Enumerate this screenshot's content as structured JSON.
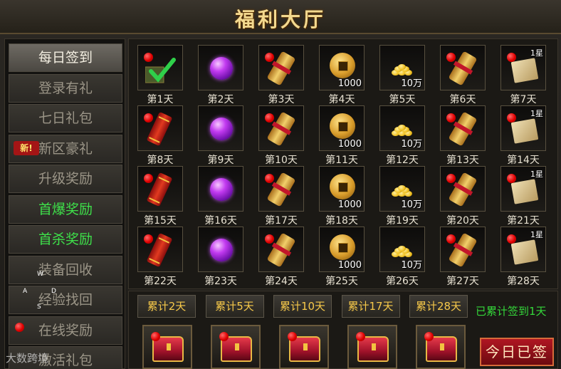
{
  "window": {
    "title": "福利大厅"
  },
  "sidebar": {
    "items": [
      {
        "label": "每日签到",
        "state": "active"
      },
      {
        "label": "登录有礼",
        "state": "normal"
      },
      {
        "label": "七日礼包",
        "state": "normal"
      },
      {
        "label": "新区豪礼",
        "state": "normal",
        "badge": "新!"
      },
      {
        "label": "升级奖励",
        "state": "normal"
      },
      {
        "label": "首爆奖励",
        "state": "highlight"
      },
      {
        "label": "首杀奖励",
        "state": "highlight"
      },
      {
        "label": "装备回收",
        "state": "normal"
      },
      {
        "label": "经验找回",
        "state": "normal"
      },
      {
        "label": "在线奖励",
        "state": "normal",
        "reddot": true
      },
      {
        "label": "激活礼包",
        "state": "normal"
      }
    ]
  },
  "signin_grid": {
    "days": [
      {
        "label": "第1天",
        "item": "check-bundle",
        "reddot": true
      },
      {
        "label": "第2天",
        "item": "purple-orb"
      },
      {
        "label": "第3天",
        "item": "scroll",
        "reddot": true
      },
      {
        "label": "第4天",
        "item": "coin",
        "qty": "1000"
      },
      {
        "label": "第5天",
        "item": "gold-pile",
        "qty": "10万"
      },
      {
        "label": "第6天",
        "item": "scroll",
        "reddot": true
      },
      {
        "label": "第7天",
        "item": "paper",
        "reddot": true,
        "star": "1星"
      },
      {
        "label": "第8天",
        "item": "firecracker",
        "reddot": true
      },
      {
        "label": "第9天",
        "item": "purple-orb"
      },
      {
        "label": "第10天",
        "item": "scroll",
        "reddot": true
      },
      {
        "label": "第11天",
        "item": "coin",
        "qty": "1000"
      },
      {
        "label": "第12天",
        "item": "gold-pile",
        "qty": "10万"
      },
      {
        "label": "第13天",
        "item": "scroll",
        "reddot": true
      },
      {
        "label": "第14天",
        "item": "paper",
        "reddot": true,
        "star": "1星"
      },
      {
        "label": "第15天",
        "item": "firecracker",
        "reddot": true
      },
      {
        "label": "第16天",
        "item": "purple-orb"
      },
      {
        "label": "第17天",
        "item": "scroll",
        "reddot": true
      },
      {
        "label": "第18天",
        "item": "coin",
        "qty": "1000"
      },
      {
        "label": "第19天",
        "item": "gold-pile",
        "qty": "10万"
      },
      {
        "label": "第20天",
        "item": "scroll",
        "reddot": true
      },
      {
        "label": "第21天",
        "item": "paper",
        "reddot": true,
        "star": "1星"
      },
      {
        "label": "第22天",
        "item": "firecracker",
        "reddot": true
      },
      {
        "label": "第23天",
        "item": "purple-orb"
      },
      {
        "label": "第24天",
        "item": "scroll",
        "reddot": true
      },
      {
        "label": "第25天",
        "item": "coin",
        "qty": "1000"
      },
      {
        "label": "第26天",
        "item": "gold-pile",
        "qty": "10万"
      },
      {
        "label": "第27天",
        "item": "scroll",
        "reddot": true
      },
      {
        "label": "第28天",
        "item": "paper",
        "reddot": true,
        "star": "1星"
      }
    ]
  },
  "cumulative": {
    "buttons": [
      "累计2天",
      "累计5天",
      "累计10天",
      "累计17天",
      "累计28天"
    ],
    "status": "已累计签到1天",
    "chest_count": 5
  },
  "action": {
    "signed_label": "今日已签"
  },
  "overlay": {
    "watermark": "大数跨境",
    "key_hints": [
      "W",
      "A",
      "S",
      "D"
    ]
  }
}
